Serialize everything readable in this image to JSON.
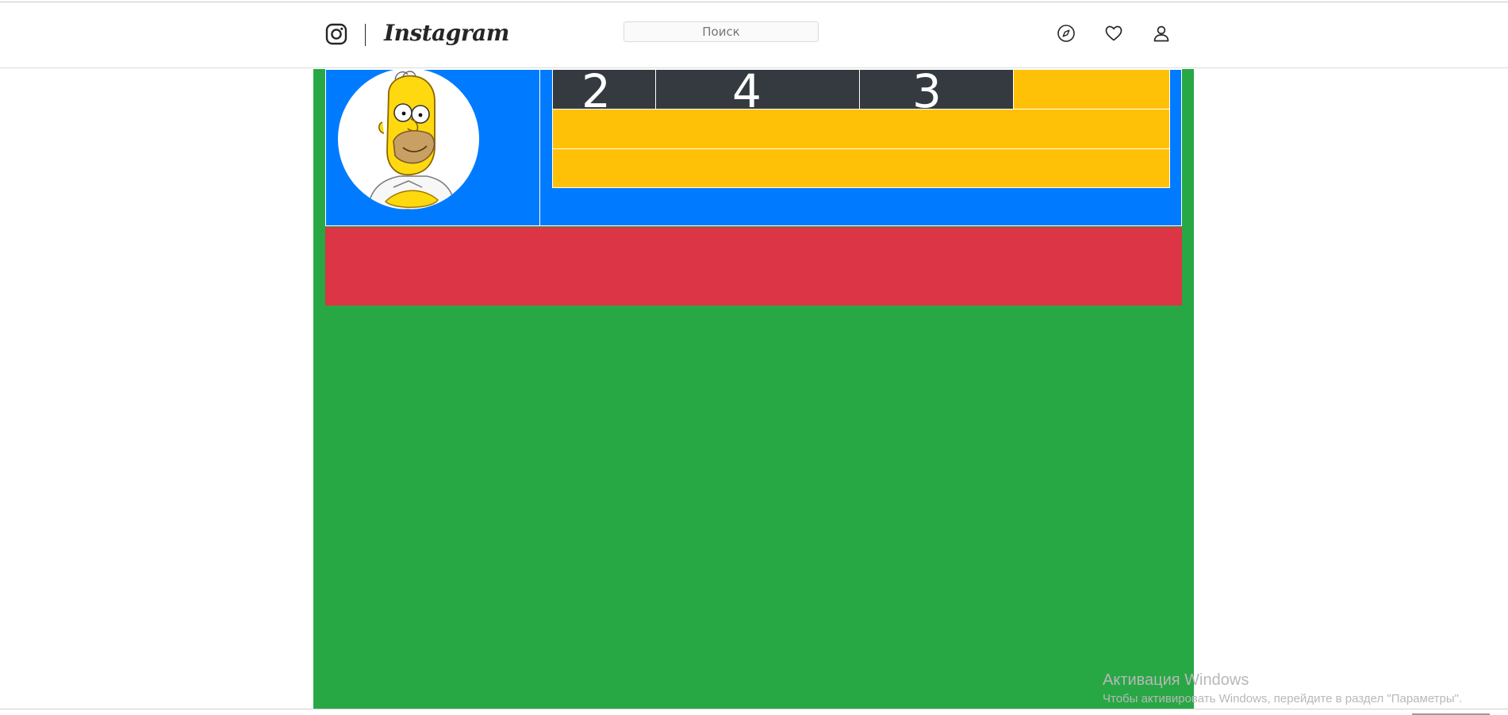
{
  "navbar": {
    "logo_icon": "instagram-camera-icon",
    "logo_text": "Instagram",
    "search": {
      "placeholder": "Поиск"
    },
    "icons": [
      "compass-icon",
      "heart-icon",
      "user-icon"
    ]
  },
  "profile": {
    "avatar": "homer-simpson-avatar",
    "stats": [
      {
        "value": "2"
      },
      {
        "value": "4"
      },
      {
        "value": "3"
      }
    ]
  },
  "colors": {
    "page_bg": "#28a745",
    "header_bg": "#007bff",
    "stats_bg": "#ffc107",
    "stat_cell_bg": "#343a40",
    "red_block": "#dc3545"
  },
  "watermark": {
    "title": "Активация Windows",
    "subtitle": "Чтобы активировать Windows, перейдите в раздел \"Параметры\"."
  }
}
